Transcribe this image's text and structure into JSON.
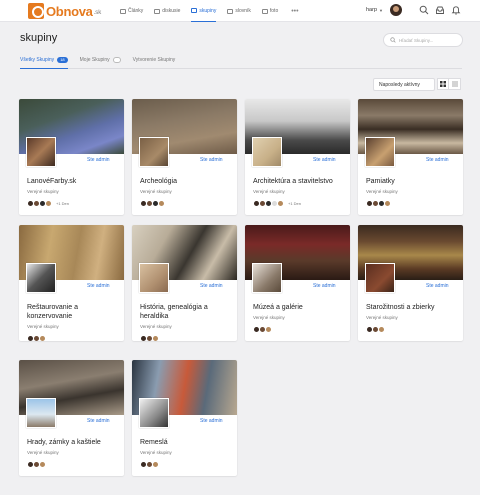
{
  "brand": {
    "name": "Obnova",
    "suffix": ".sk"
  },
  "nav": [
    {
      "label": "Články",
      "active": false
    },
    {
      "label": "diskusie",
      "active": false
    },
    {
      "label": "skupiny",
      "active": true
    },
    {
      "label": "slovník",
      "active": false
    },
    {
      "label": "foto",
      "active": false
    }
  ],
  "nav_more": "•••",
  "user": {
    "name": "harp"
  },
  "page": {
    "title": "skupiny"
  },
  "search": {
    "placeholder": "Hľadať Skupiny..."
  },
  "tabs": [
    {
      "label": "Všetky Skupiny",
      "count": "18",
      "active": true
    },
    {
      "label": "Moje Skupiny",
      "count": "",
      "active": false
    },
    {
      "label": "Vytvorenie Skupiny",
      "count": null,
      "active": false
    }
  ],
  "sort": {
    "selected": "Naposledy aktívny"
  },
  "groups": [
    {
      "name": "LanovéFarby.sk",
      "admin": "Ste admin",
      "type": "Verejné skupiny",
      "extra": "+1 Den"
    },
    {
      "name": "Archeológia",
      "admin": "Ste admin",
      "type": "Verejné skupiny",
      "extra": ""
    },
    {
      "name": "Architektúra a stavitelstvo",
      "admin": "Ste admin",
      "type": "Verejné skupiny",
      "extra": "+1 Den"
    },
    {
      "name": "Pamiatky",
      "admin": "Ste admin",
      "type": "Verejné skupiny",
      "extra": ""
    },
    {
      "name": "Reštaurovanie a konzervovanie",
      "admin": "Ste admin",
      "type": "Verejné skupiny",
      "extra": ""
    },
    {
      "name": "História, genealógia a heraldika",
      "admin": "Ste admin",
      "type": "Verejné skupiny",
      "extra": ""
    },
    {
      "name": "Múzeá a galérie",
      "admin": "Ste admin",
      "type": "Verejné skupiny",
      "extra": ""
    },
    {
      "name": "Starožitnosti a zbierky",
      "admin": "Ste admin",
      "type": "Verejné skupiny",
      "extra": ""
    },
    {
      "name": "Hrady, zámky a kaštiele",
      "admin": "Ste admin",
      "type": "Verejné skupiny",
      "extra": ""
    },
    {
      "name": "Remeslá",
      "admin": "Ste admin",
      "type": "Verejné skupiny",
      "extra": ""
    }
  ],
  "colors": {
    "accent": "#2a6fd6",
    "brand": "#e57a1f"
  }
}
